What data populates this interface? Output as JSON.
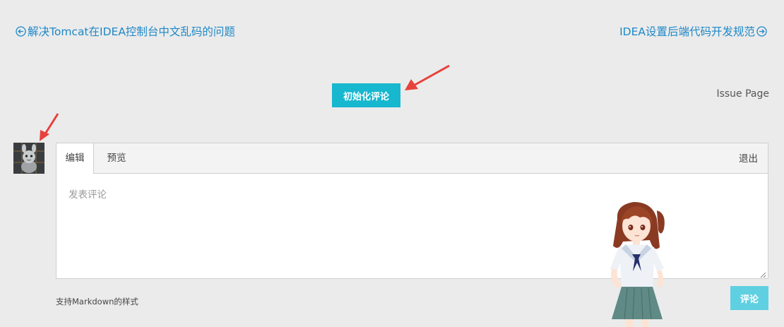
{
  "nav": {
    "prev_label": "解决Tomcat在IDEA控制台中文乱码的问题",
    "next_label": "IDEA设置后端代码开发规范",
    "prev_icon": "circle-arrow-left-icon",
    "next_icon": "circle-arrow-right-icon"
  },
  "comments": {
    "init_button": "初始化评论",
    "issue_link": "Issue Page",
    "tabs": {
      "edit": "编辑",
      "preview": "预览"
    },
    "logout": "退出",
    "textarea_placeholder": "发表评论",
    "markdown_hint": "支持Markdown的样式",
    "submit_button": "评论"
  },
  "colors": {
    "link": "#1e88c7",
    "init_button_bg": "#17b7cf",
    "submit_button_bg": "#5fd0e1",
    "annotation_arrow": "#e8413c",
    "page_bg": "#ebebeb"
  }
}
